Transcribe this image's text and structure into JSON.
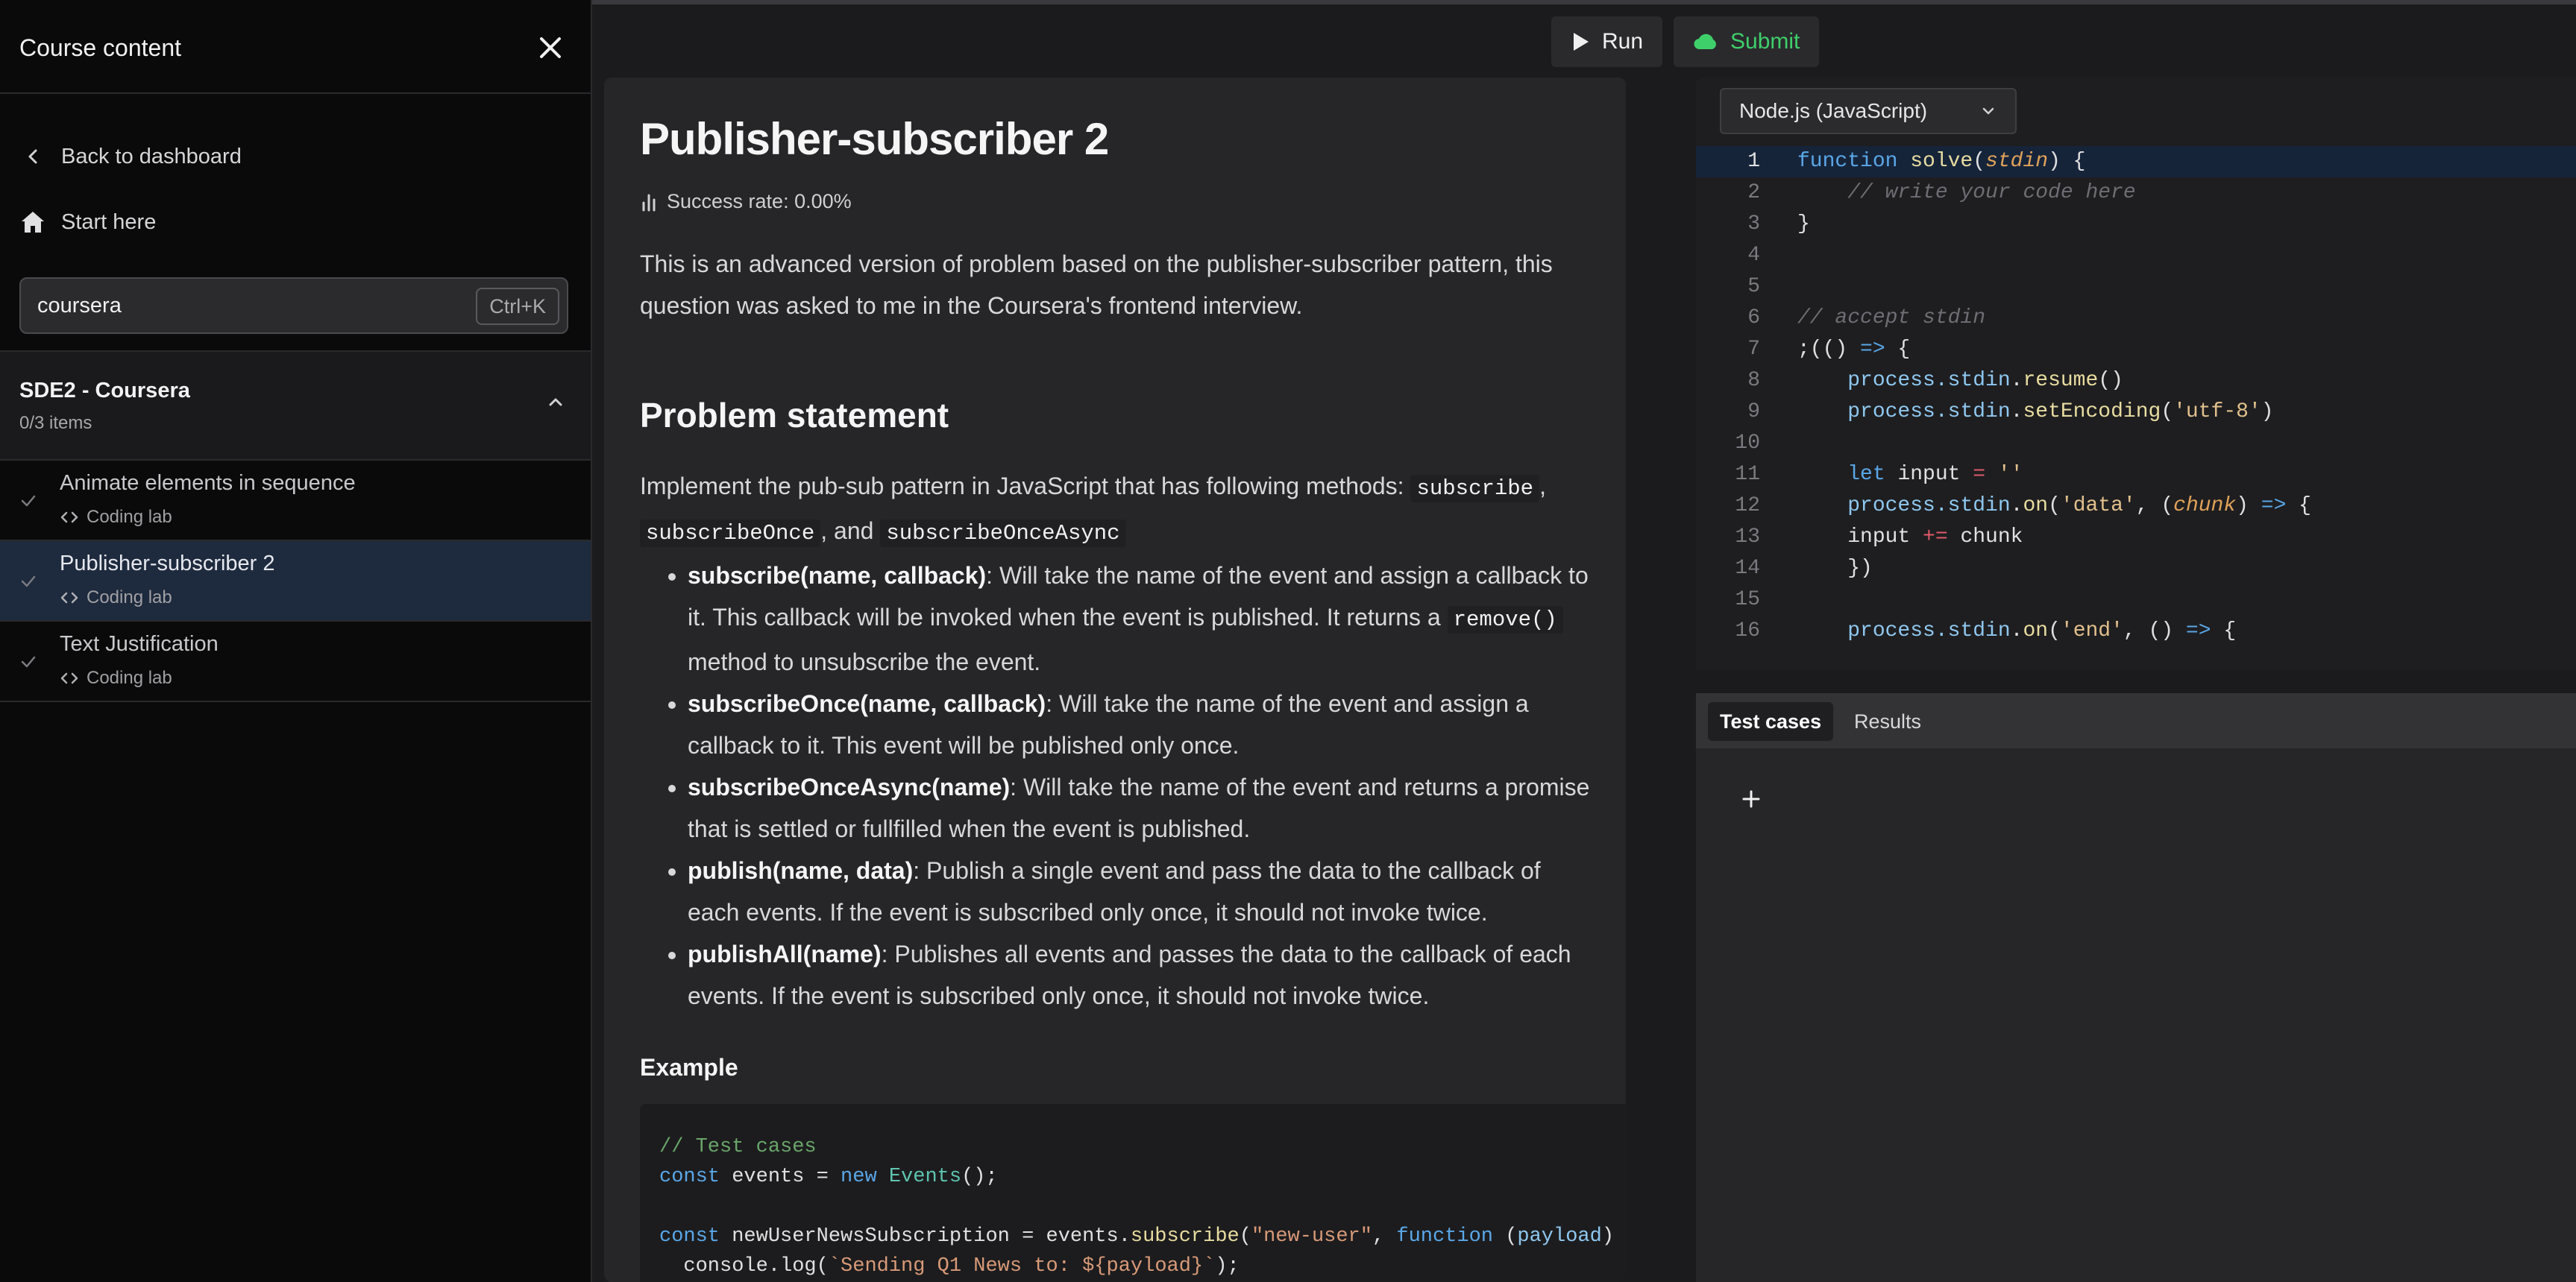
{
  "sidebar": {
    "title": "Course content",
    "back_label": "Back to dashboard",
    "start_label": "Start here",
    "search": {
      "value": "coursera",
      "shortcut": "Ctrl+K"
    },
    "section": {
      "title": "SDE2 - Coursera",
      "progress": "0/3 items"
    },
    "lessons": [
      {
        "title": "Animate elements in sequence",
        "type": "Coding lab"
      },
      {
        "title": "Publisher-subscriber 2",
        "type": "Coding lab"
      },
      {
        "title": "Text Justification",
        "type": "Coding lab"
      }
    ]
  },
  "toolbar": {
    "run_label": "Run",
    "submit_label": "Submit",
    "submit_color": "#3fcf6a"
  },
  "problem": {
    "title": "Publisher-subscriber 2",
    "success_rate": "Success rate: 0.00%",
    "intro": "This is an advanced version of problem based on the publisher-subscriber pattern, this question was asked to me in the Coursera's frontend interview.",
    "statement_heading": "Problem statement",
    "statement_pre": "Implement the pub-sub pattern in JavaScript that has following methods:",
    "method_subscribe": "subscribe",
    "method_subscribe_once": "subscribeOnce",
    "and_text": ", and",
    "method_subscribe_once_async": "subscribeOnceAsync",
    "methods": [
      {
        "name": "subscribe(name, callback)",
        "desc_1": ": Will take the name of the event and assign a callback to it. This callback will be invoked when the event is published. It returns a",
        "code": "remove()",
        "desc_2": "method to unsubscribe the event."
      },
      {
        "name": "subscribeOnce(name, callback)",
        "desc_1": ": Will take the name of the event and assign a callback to it. This event will be published only once."
      },
      {
        "name": "subscribeOnceAsync(name)",
        "desc_1": ": Will take the name of the event and returns a promise that is settled or fullfilled when the event is published."
      },
      {
        "name": "publish(name, data)",
        "desc_1": ": Publish a single event and pass the data to the callback of each events. If the event is subscribed only once, it should not invoke twice."
      },
      {
        "name": "publishAll(name)",
        "desc_1": ": Publishes all events and passes the data to the callback of each events. If the event is subscribed only once, it should not invoke twice."
      }
    ],
    "example_heading": "Example",
    "example_code": {
      "line1": "// Test cases",
      "line2_a": "const",
      "line2_b": " events = ",
      "line2_c": "new",
      "line2_d": " Events",
      "line2_e": "();",
      "line4_a": "const",
      "line4_b": " newUserNewsSubscription = events.",
      "line4_c": "subscribe",
      "line4_d": "(",
      "line4_e": "\"new-user\"",
      "line4_f": ", ",
      "line4_g": "function",
      "line4_h": " (",
      "line4_i": "payload",
      "line4_j": ") {",
      "line5_a": "  console.log(",
      "line5_b": "`Sending Q1 News to: ${payload}`",
      "line5_c": ");"
    }
  },
  "editor": {
    "language": "Node.js (JavaScript)",
    "lines": [
      "1",
      "2",
      "3",
      "4",
      "5",
      "6",
      "7",
      "8",
      "9",
      "10",
      "11",
      "12",
      "13",
      "14",
      "15",
      "16"
    ],
    "code": {
      "l1_kw": "function",
      "l1_fn": " solve",
      "l1_p1": "(",
      "l1_prm": "stdin",
      "l1_p2": ") {",
      "l2": "    // write your code here",
      "l3": "}",
      "l6": "// accept stdin",
      "l7_a": ";(() ",
      "l7_ar": "=>",
      "l7_b": " {",
      "l8_a": "    process.",
      "l8_b": "stdin",
      "l8_c": ".",
      "l8_d": "resume",
      "l8_e": "()",
      "l9_a": "    process.",
      "l9_b": "stdin",
      "l9_c": ".",
      "l9_d": "setEncoding",
      "l9_e": "(",
      "l9_f": "'utf-8'",
      "l9_g": ")",
      "l11_a": "    ",
      "l11_kw": "let",
      "l11_b": " input ",
      "l11_op": "=",
      "l11_c": " ",
      "l11_str": "''",
      "l12_a": "    process.",
      "l12_b": "stdin",
      "l12_c": ".",
      "l12_d": "on",
      "l12_e": "(",
      "l12_f": "'data'",
      "l12_g": ", (",
      "l12_prm": "chunk",
      "l12_h": ") ",
      "l12_ar": "=>",
      "l12_i": " {",
      "l13_a": "    input ",
      "l13_op": "+=",
      "l13_b": " chunk",
      "l14": "    })",
      "l16_a": "    process.",
      "l16_b": "stdin",
      "l16_c": ".",
      "l16_d": "on",
      "l16_e": "(",
      "l16_f": "'end'",
      "l16_g": ", () ",
      "l16_ar": "=>",
      "l16_h": " {"
    }
  },
  "tests": {
    "tab_cases": "Test cases",
    "tab_results": "Results",
    "add_symbol": "+"
  }
}
